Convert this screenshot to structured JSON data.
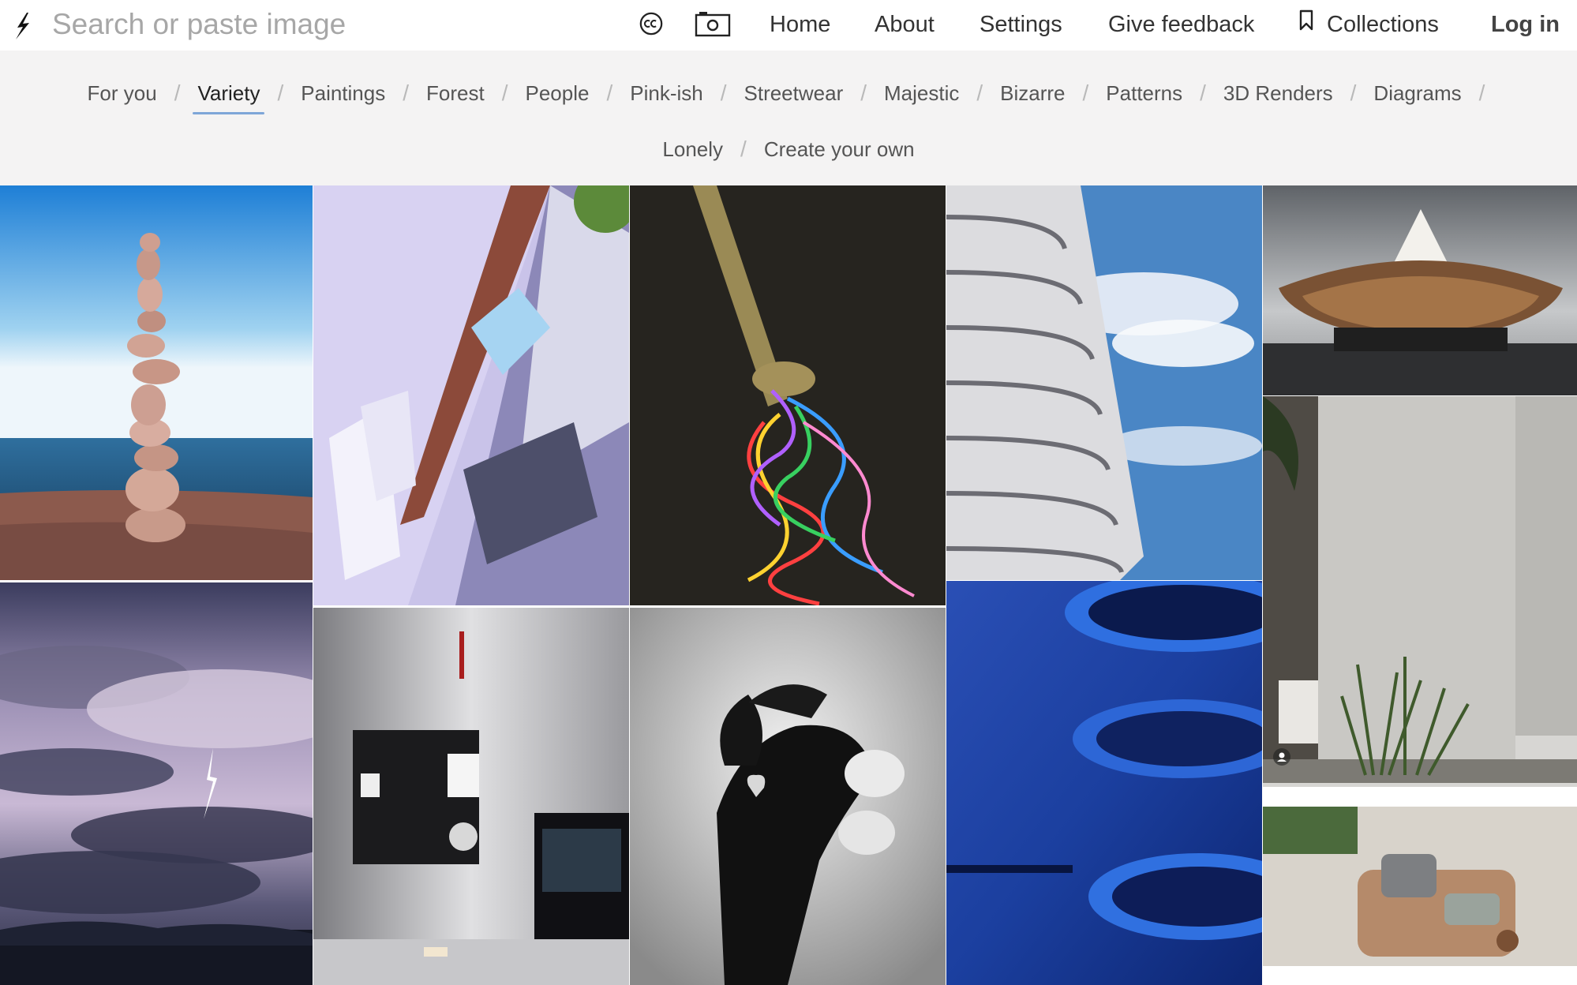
{
  "search": {
    "placeholder": "Search or paste image"
  },
  "icons": {
    "logo": "lightning-bolt-icon",
    "cc": "creative-commons-icon",
    "camera": "camera-icon",
    "bookmark": "bookmark-icon",
    "user": "user-icon"
  },
  "nav": {
    "home": "Home",
    "about": "About",
    "settings": "Settings",
    "feedback": "Give feedback",
    "collections": "Collections",
    "login": "Log in"
  },
  "categories": {
    "row1": [
      "For you",
      "Variety",
      "Paintings",
      "Forest",
      "People",
      "Pink-ish",
      "Streetwear",
      "Majestic",
      "Bizarre",
      "Patterns",
      "3D Renders",
      "Diagrams"
    ],
    "row2": [
      "Lonely",
      "Create your own"
    ],
    "active": "Variety"
  },
  "colors": {
    "accent_underline": "#7ea6d8",
    "category_bar_bg": "#f4f3f3"
  }
}
